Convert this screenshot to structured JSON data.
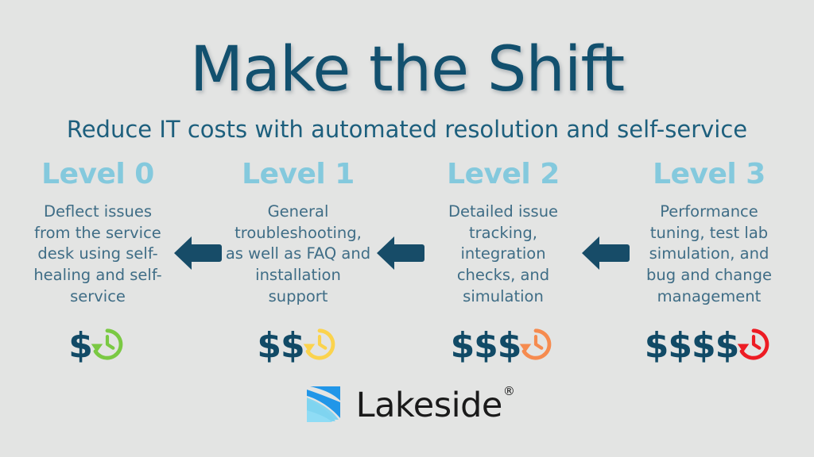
{
  "background_color": "#e3e4e3",
  "header": {
    "title": "Make the Shift",
    "subtitle": "Reduce IT costs with automated resolution and self-service",
    "title_color": "#12506e",
    "subtitle_color": "#1d5f7d"
  },
  "level_title_color": "#84c9dd",
  "body_text_color": "#3f6d86",
  "dollar_color": "#114a66",
  "arrow_color": "#174c68",
  "columns": [
    {
      "title": "Level 0",
      "body": "Deflect issues from the service desk using self-healing and self-service",
      "dollars": "$",
      "dollar_count": 1,
      "clock_color": "#7ac943",
      "clock_icon": "clock-rotate-left-icon"
    },
    {
      "title": "Level 1",
      "body": "General troubleshooting, as well as FAQ and installation support",
      "dollars": "$$",
      "dollar_count": 2,
      "clock_color": "#fbd34d",
      "clock_icon": "clock-rotate-left-icon"
    },
    {
      "title": "Level 2",
      "body": "Detailed issue tracking, integration checks, and simulation",
      "dollars": "$$$",
      "dollar_count": 3,
      "clock_color": "#f68b4f",
      "clock_icon": "clock-rotate-left-icon"
    },
    {
      "title": "Level 3",
      "body": "Performance tuning, test lab simulation, and bug and change management",
      "dollars": "$$$$",
      "dollar_count": 4,
      "clock_color": "#ed1c24",
      "clock_icon": "clock-rotate-left-icon"
    }
  ],
  "arrows": [
    {
      "icon": "arrow-left-icon",
      "direction": "left"
    },
    {
      "icon": "arrow-left-icon",
      "direction": "left"
    },
    {
      "icon": "arrow-left-icon",
      "direction": "left"
    }
  ],
  "logo": {
    "mark_icon": "lakeside-wave-mark-icon",
    "name": "Lakeside",
    "registered_mark": "®",
    "mark_color_dark": "#2196e8",
    "mark_color_light": "#7fd4f0",
    "word_color": "#1a1a1a"
  }
}
